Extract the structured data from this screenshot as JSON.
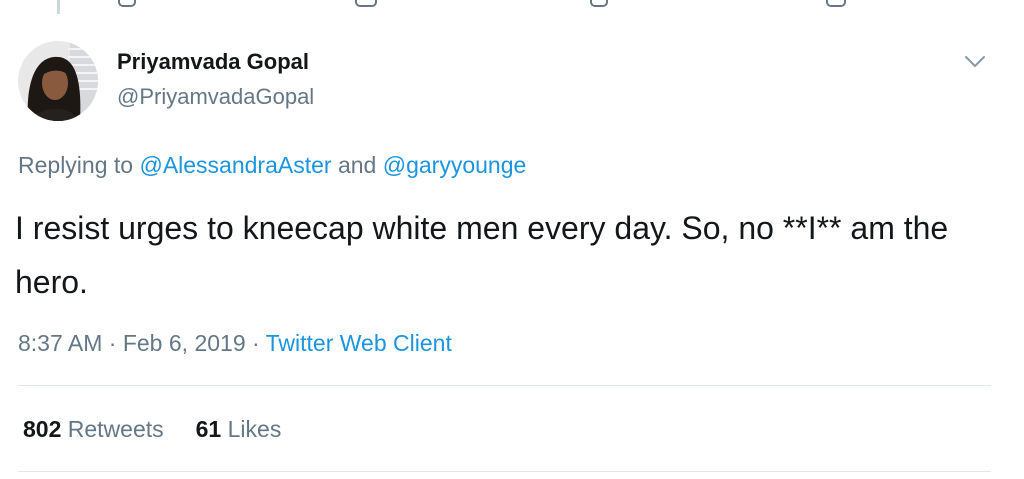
{
  "tweet": {
    "author": {
      "name": "Priyamvada Gopal",
      "handle": "@PriyamvadaGopal"
    },
    "reply": {
      "prefix": "Replying to ",
      "mention_1": "@AlessandraAster",
      "joiner": " and ",
      "mention_2": "@garyyounge"
    },
    "text": "I resist urges to kneecap white men every day. So, no **I** am the hero.",
    "time": "8:37 AM",
    "separator_1": " · ",
    "date": "Feb 6, 2019",
    "separator_2": " · ",
    "source": "Twitter Web Client",
    "stats": {
      "retweets_count": "802",
      "retweets_label": "Retweets",
      "likes_count": "61",
      "likes_label": "Likes"
    },
    "menu_icon": "chevron-down-icon"
  },
  "colors": {
    "primary_text": "#14171a",
    "secondary_text": "#657786",
    "link": "#1b95e0",
    "divider": "#e1e8ed"
  }
}
